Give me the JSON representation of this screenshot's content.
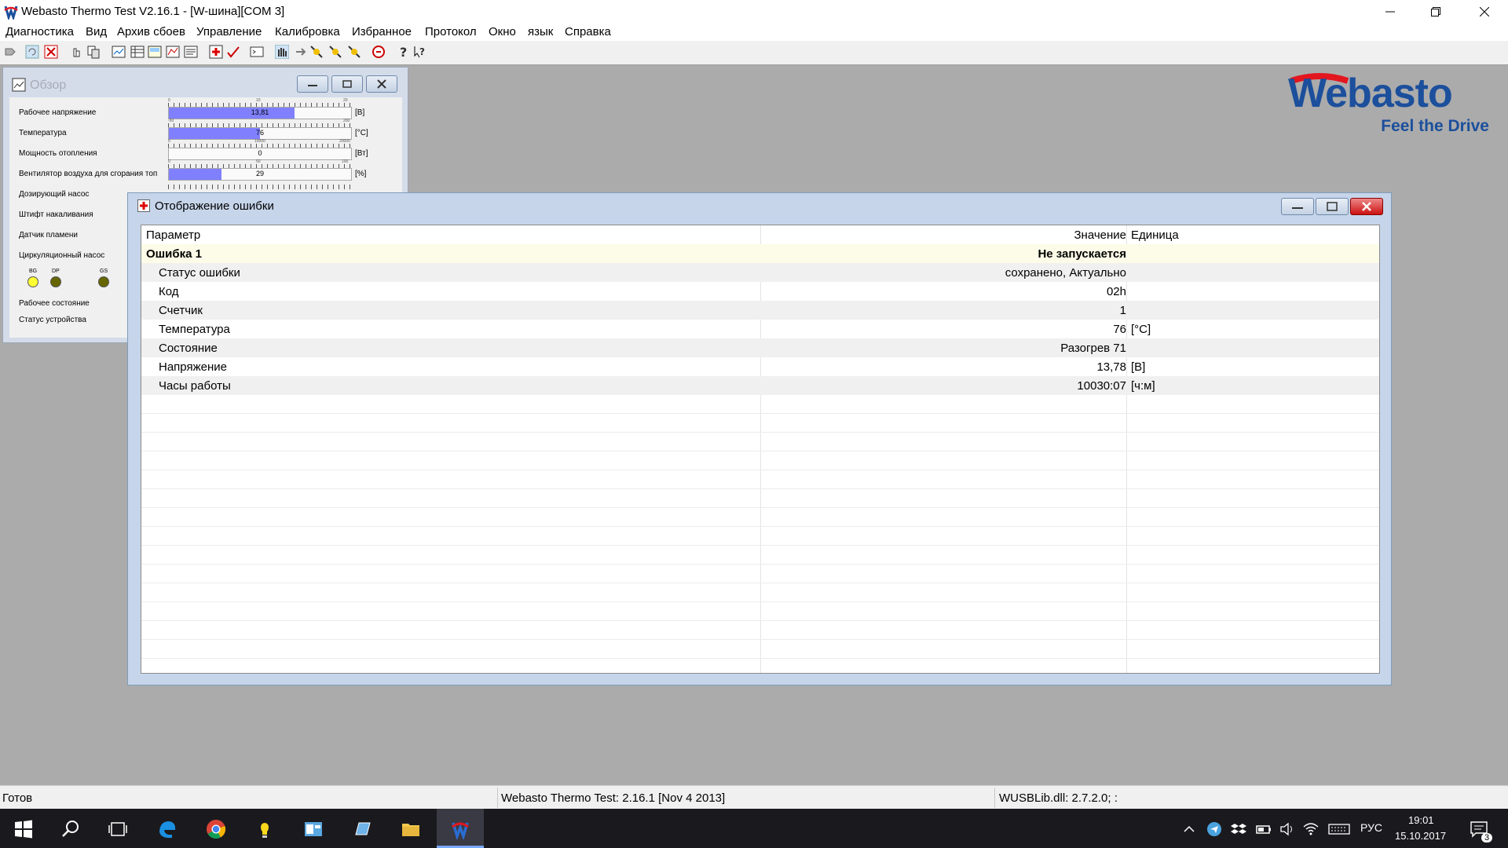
{
  "window": {
    "title": "Webasto Thermo Test V2.16.1 - [W-шина][COM 3]"
  },
  "menu": [
    "Диагностика",
    "Вид",
    "Архив сбоев",
    "Управление",
    "Калибровка",
    "Избранное",
    "Протокол",
    "Окно",
    "язык",
    "Справка"
  ],
  "brand": {
    "logo_text": "Webasto",
    "tagline": "Feel the Drive",
    "color": "#1c4f9c",
    "accent": "#e3161f"
  },
  "overview": {
    "title": "Обзор",
    "rows": [
      {
        "label": "Рабочее напряжение",
        "value": "13,81",
        "fraction": 0.69,
        "unit": "[В]",
        "scale": [
          "0",
          "10",
          "20"
        ]
      },
      {
        "label": "Температура",
        "value": "76",
        "fraction": 0.5,
        "unit": "[°C]",
        "scale": [
          "-50",
          "",
          "200"
        ]
      },
      {
        "label": "Мощность отопления",
        "value": "0",
        "fraction": 0.0,
        "unit": "[Вт]",
        "scale": [
          "0",
          "10000",
          "20000"
        ]
      },
      {
        "label": "Вентилятор воздуха для сгорания топ",
        "value": "29",
        "fraction": 0.29,
        "unit": "[%]",
        "scale": [
          "0",
          "50",
          "100"
        ]
      },
      {
        "label": "Дозирующий насос",
        "value": "",
        "fraction": 0.0,
        "unit": "",
        "scale": [
          "",
          "",
          ""
        ]
      }
    ],
    "extra_labels": [
      "Штифт накаливания",
      "Датчик пламени",
      "Циркуляционный насос"
    ],
    "leds": [
      {
        "label": "BG",
        "color": "#ffff33"
      },
      {
        "label": "DP",
        "color": "#666600"
      },
      {
        "label": "GS",
        "color": "#666600"
      }
    ],
    "footer_labels": [
      "Рабочее состояние",
      "Статус устройства"
    ]
  },
  "error_window": {
    "title": "Отображение ошибки",
    "columns": {
      "param": "Параметр",
      "value": "Значение",
      "unit": "Единица"
    },
    "header_row": {
      "param": "Ошибка 1",
      "value": "Не запускается"
    },
    "rows": [
      {
        "param": "Статус ошибки",
        "value": "сохранено, Актуально",
        "unit": ""
      },
      {
        "param": "Код",
        "value": "02h",
        "unit": ""
      },
      {
        "param": "Счетчик",
        "value": "1",
        "unit": ""
      },
      {
        "param": "Температура",
        "value": "76",
        "unit": "[°C]"
      },
      {
        "param": "Состояние",
        "value": "Разогрев 71",
        "unit": ""
      },
      {
        "param": "Напряжение",
        "value": "13,78",
        "unit": "[В]"
      },
      {
        "param": "Часы работы",
        "value": "10030:07",
        "unit": "[ч:м]"
      }
    ]
  },
  "status_bar": {
    "left": "Готов",
    "middle": "Webasto Thermo Test: 2.16.1 [Nov  4 2013]",
    "right": "WUSBLib.dll: 2.7.2.0; :"
  },
  "taskbar": {
    "lang": "РУС",
    "time": "19:01",
    "date": "15.10.2017",
    "notifications": "3"
  }
}
